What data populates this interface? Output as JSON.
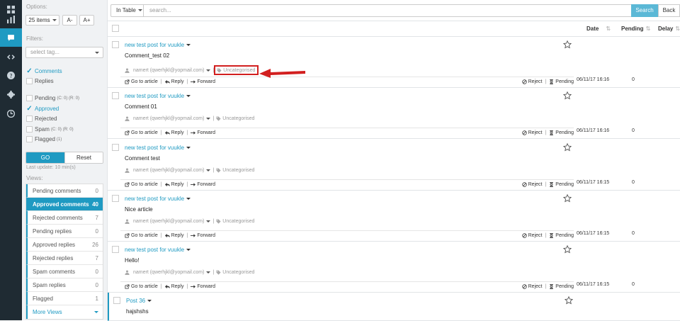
{
  "sidebar": {
    "options_label": "Options:",
    "items_select": "25 items",
    "font_smaller": "A-",
    "font_larger": "A+",
    "filters_label": "Filters:",
    "tag_placeholder": "select tag...",
    "type_filters": [
      {
        "label": "Comments",
        "checked": true
      },
      {
        "label": "Replies",
        "checked": false
      }
    ],
    "status_filters": [
      {
        "label": "Pending",
        "counts": "(C: 0) (R: 0)",
        "checked": false
      },
      {
        "label": "Approved",
        "counts": "",
        "checked": true
      },
      {
        "label": "Rejected",
        "counts": "",
        "checked": false
      },
      {
        "label": "Spam",
        "counts": "(C: 0) (R: 0)",
        "checked": false
      },
      {
        "label": "Flagged",
        "counts": "(1)",
        "checked": false
      }
    ],
    "go_label": "GO",
    "reset_label": "Reset",
    "last_update": "Last update: 10 min(s)",
    "views_label": "Views:",
    "views": [
      {
        "label": "Pending comments",
        "count": "0"
      },
      {
        "label": "Approved comments",
        "count": "40",
        "active": true
      },
      {
        "label": "Rejected comments",
        "count": "7"
      },
      {
        "label": "Pending replies",
        "count": "0"
      },
      {
        "label": "Approved replies",
        "count": "26"
      },
      {
        "label": "Rejected replies",
        "count": "7"
      },
      {
        "label": "Spam comments",
        "count": "0"
      },
      {
        "label": "Spam replies",
        "count": "0"
      },
      {
        "label": "Flagged",
        "count": "1"
      }
    ],
    "more_views": "More Views"
  },
  "toolbar": {
    "view_mode": "In Table",
    "search_placeholder": "search...",
    "search_button": "Search",
    "back_button": "Back"
  },
  "columns": {
    "date": "Date",
    "pending": "Pending",
    "delay": "Delay"
  },
  "actions": {
    "go_to_article": "Go to article",
    "reply": "Reply",
    "forward": "Forward",
    "reject": "Reject",
    "pending": "Pending"
  },
  "comments": [
    {
      "post": "new test post for vuukle",
      "text": "Comment_test 02",
      "author": "namert (qwerhjkl@yopmail.com)",
      "tag": "Uncategorised",
      "date": "06/11/17 16:16",
      "pending": "0"
    },
    {
      "post": "new test post for vuukle",
      "text": "Comment 01",
      "author": "namert (qwerhjkl@yopmail.com)",
      "tag": "Uncategorised",
      "date": "06/11/17 16:16",
      "pending": "0"
    },
    {
      "post": "new test post for vuukle",
      "text": "Comment test",
      "author": "namert (qwerhjkl@yopmail.com)",
      "tag": "Uncategorised",
      "date": "06/11/17 16:15",
      "pending": "0"
    },
    {
      "post": "new test post for vuukle",
      "text": "Nice article",
      "author": "namert (qwerhjkl@yopmail.com)",
      "tag": "Uncategorised",
      "date": "06/11/17 16:15",
      "pending": "0"
    },
    {
      "post": "new test post for vuukle",
      "text": "Hello!",
      "author": "namert (qwerhjkl@yopmail.com)",
      "tag": "Uncategorised",
      "date": "06/11/17 16:15",
      "pending": "0"
    },
    {
      "post": "Post 36",
      "text": "hajshshs"
    }
  ],
  "colors": {
    "accent": "#1f9ac2",
    "rail": "#1f2b33",
    "highlight": "#d21f1f"
  }
}
